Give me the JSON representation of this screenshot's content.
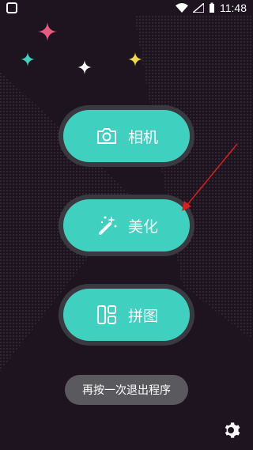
{
  "status_bar": {
    "time": "11:48",
    "icons": [
      "wifi-icon",
      "signal-icon",
      "battery-icon"
    ]
  },
  "menu": {
    "items": [
      {
        "label": "相机",
        "icon": "camera-icon"
      },
      {
        "label": "美化",
        "icon": "magic-wand-icon"
      },
      {
        "label": "拼图",
        "icon": "collage-icon"
      }
    ]
  },
  "toast": {
    "text": "再按一次退出程序"
  },
  "settings": {
    "icon": "gear-icon"
  },
  "colors": {
    "background": "#1e1420",
    "button_fill": "#3fd0c0",
    "button_ring": "#3b3940",
    "annotation_arrow": "#d81e1e",
    "sparkle_pink": "#e85a82",
    "sparkle_teal": "#3fd0c0",
    "sparkle_yellow": "#f0d94a"
  }
}
